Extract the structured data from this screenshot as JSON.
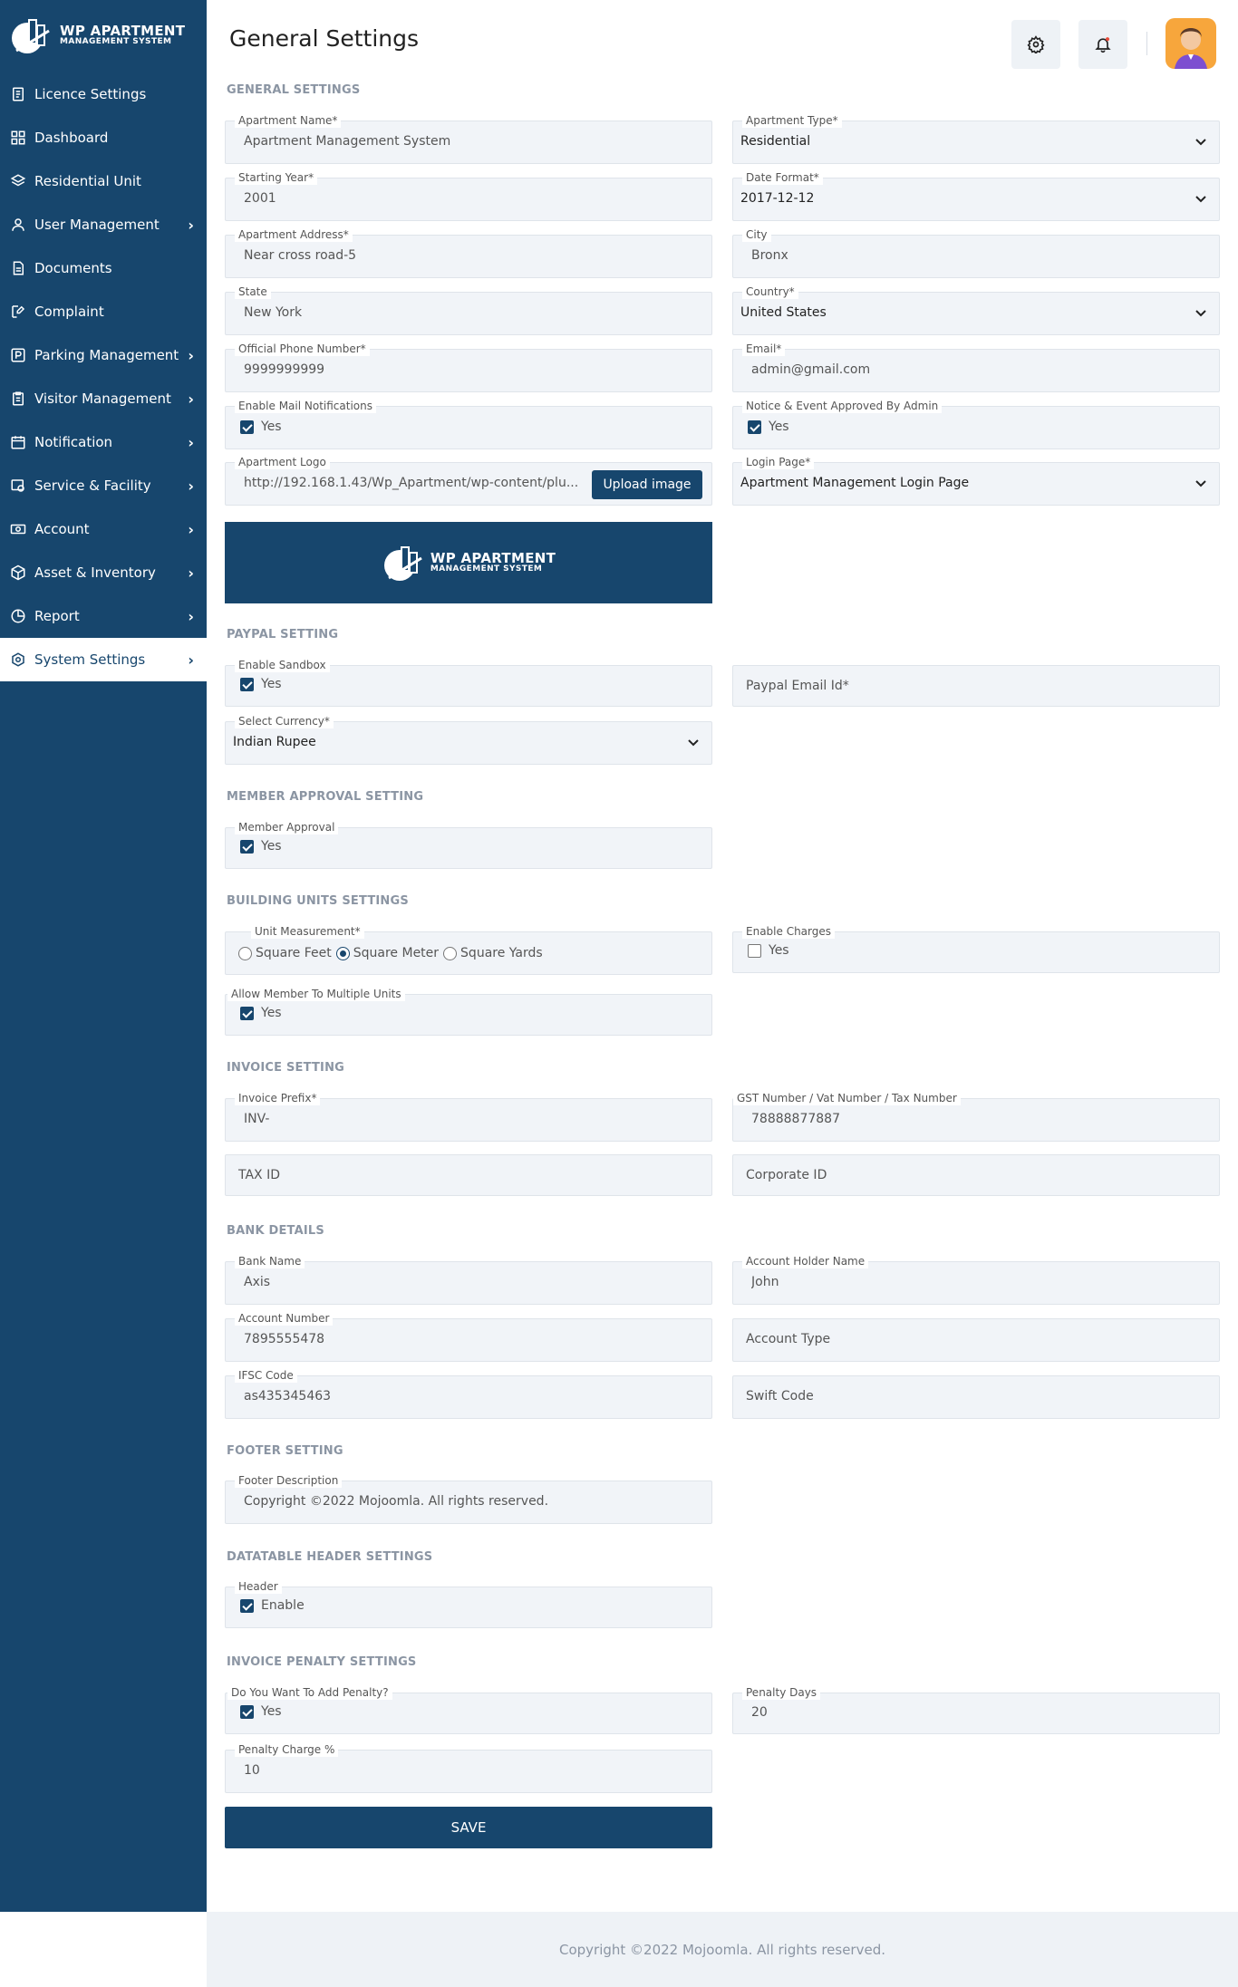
{
  "brand": {
    "line1": "WP APARTMENT",
    "line2": "MANAGEMENT SYSTEM"
  },
  "sidebar": {
    "items": [
      {
        "label": "Licence Settings",
        "icon": "document-icon",
        "chevron": false
      },
      {
        "label": "Dashboard",
        "icon": "grid-icon",
        "chevron": false
      },
      {
        "label": "Residential Unit",
        "icon": "layers-icon",
        "chevron": false
      },
      {
        "label": "User Management",
        "icon": "user-icon",
        "chevron": true
      },
      {
        "label": "Documents",
        "icon": "file-icon",
        "chevron": false
      },
      {
        "label": "Complaint",
        "icon": "edit-icon",
        "chevron": false
      },
      {
        "label": "Parking Management",
        "icon": "parking-icon",
        "chevron": true
      },
      {
        "label": "Visitor Management",
        "icon": "clipboard-icon",
        "chevron": true
      },
      {
        "label": "Notification",
        "icon": "calendar-icon",
        "chevron": true
      },
      {
        "label": "Service & Facility",
        "icon": "service-icon",
        "chevron": true
      },
      {
        "label": "Account",
        "icon": "money-icon",
        "chevron": true
      },
      {
        "label": "Asset & Inventory",
        "icon": "box-icon",
        "chevron": true
      },
      {
        "label": "Report",
        "icon": "pie-icon",
        "chevron": true
      },
      {
        "label": "System Settings",
        "icon": "gear-icon",
        "chevron": true,
        "active": true
      }
    ],
    "chevron": "›"
  },
  "header": {
    "title": "General Settings"
  },
  "sections": {
    "general": "GENERAL SETTINGS",
    "paypal": "PAYPAL SETTING",
    "member": "MEMBER APPROVAL SETTING",
    "building": "BUILDING UNITS SETTINGS",
    "invoice": "INVOICE SETTING",
    "bank": "BANK DETAILS",
    "footer": "FOOTER SETTING",
    "datatable": "DATATABLE HEADER SETTINGS",
    "penalty": "INVOICE PENALTY SETTINGS"
  },
  "general": {
    "apartment_name": {
      "label": "Apartment Name*",
      "value": "Apartment Management System"
    },
    "apartment_type": {
      "label": "Apartment Type*",
      "value": "Residential"
    },
    "starting_year": {
      "label": "Starting Year*",
      "value": "2001"
    },
    "date_format": {
      "label": "Date Format*",
      "value": "2017-12-12"
    },
    "address": {
      "label": "Apartment Address*",
      "value": "Near cross road-5"
    },
    "city": {
      "label": "City",
      "value": "Bronx"
    },
    "state": {
      "label": "State",
      "value": "New York"
    },
    "country": {
      "label": "Country*",
      "value": "United States"
    },
    "phone": {
      "label": "Official Phone Number*",
      "value": "9999999999"
    },
    "email": {
      "label": "Email*",
      "value": "admin@gmail.com"
    },
    "mail_notif": {
      "label": "Enable Mail Notifications",
      "value": "Yes",
      "checked": true
    },
    "notice_approved": {
      "label": "Notice & Event Approved By Admin",
      "value": "Yes",
      "checked": true
    },
    "logo": {
      "label": "Apartment Logo",
      "value": "http://192.168.1.43/Wp_Apartment/wp-content/plu...",
      "button": "Upload image"
    },
    "login_page": {
      "label": "Login Page*",
      "value": "Apartment Management Login Page"
    }
  },
  "paypal": {
    "sandbox": {
      "label": "Enable Sandbox",
      "value": "Yes",
      "checked": true
    },
    "email_placeholder": "Paypal Email Id*",
    "currency": {
      "label": "Select Currency*",
      "value": "Indian Rupee"
    }
  },
  "member": {
    "approval": {
      "label": "Member Approval",
      "value": "Yes",
      "checked": true
    }
  },
  "building": {
    "unit": {
      "label": "Unit Measurement*",
      "options": [
        "Square Feet",
        "Square Meter",
        "Square Yards"
      ],
      "selected": "Square Meter"
    },
    "charges": {
      "label": "Enable Charges",
      "value": "Yes",
      "checked": false
    },
    "multi": {
      "label": "Allow Member To Multiple Units",
      "value": "Yes",
      "checked": true
    }
  },
  "invoice": {
    "prefix": {
      "label": "Invoice Prefix*",
      "value": "INV-"
    },
    "gst": {
      "label": "GST Number / Vat Number / Tax Number",
      "value": "78888877887"
    },
    "tax_placeholder": "TAX ID",
    "corporate_placeholder": "Corporate ID"
  },
  "bank": {
    "bank_name": {
      "label": "Bank Name",
      "value": "Axis"
    },
    "holder": {
      "label": "Account Holder Name",
      "value": "John"
    },
    "account_number": {
      "label": "Account Number",
      "value": "7895555478"
    },
    "account_type_placeholder": "Account Type",
    "ifsc": {
      "label": "IFSC Code",
      "value": "as435345463"
    },
    "swift_placeholder": "Swift Code"
  },
  "footer_setting": {
    "description": {
      "label": "Footer Description",
      "value": "Copyright ©2022 Mojoomla. All rights reserved."
    }
  },
  "datatable": {
    "header": {
      "label": "Header",
      "value": "Enable",
      "checked": true
    }
  },
  "penalty": {
    "add": {
      "label": "Do You Want To Add Penalty?",
      "value": "Yes",
      "checked": true
    },
    "days": {
      "label": "Penalty Days",
      "value": "20"
    },
    "charge": {
      "label": "Penalty Charge %",
      "value": "10"
    }
  },
  "save_label": "SAVE",
  "page_footer": "Copyright ©2022 Mojoomla. All rights reserved.",
  "colors": {
    "primary": "#17466d",
    "field_bg": "#f1f4f8",
    "section": "#8b95a3"
  }
}
